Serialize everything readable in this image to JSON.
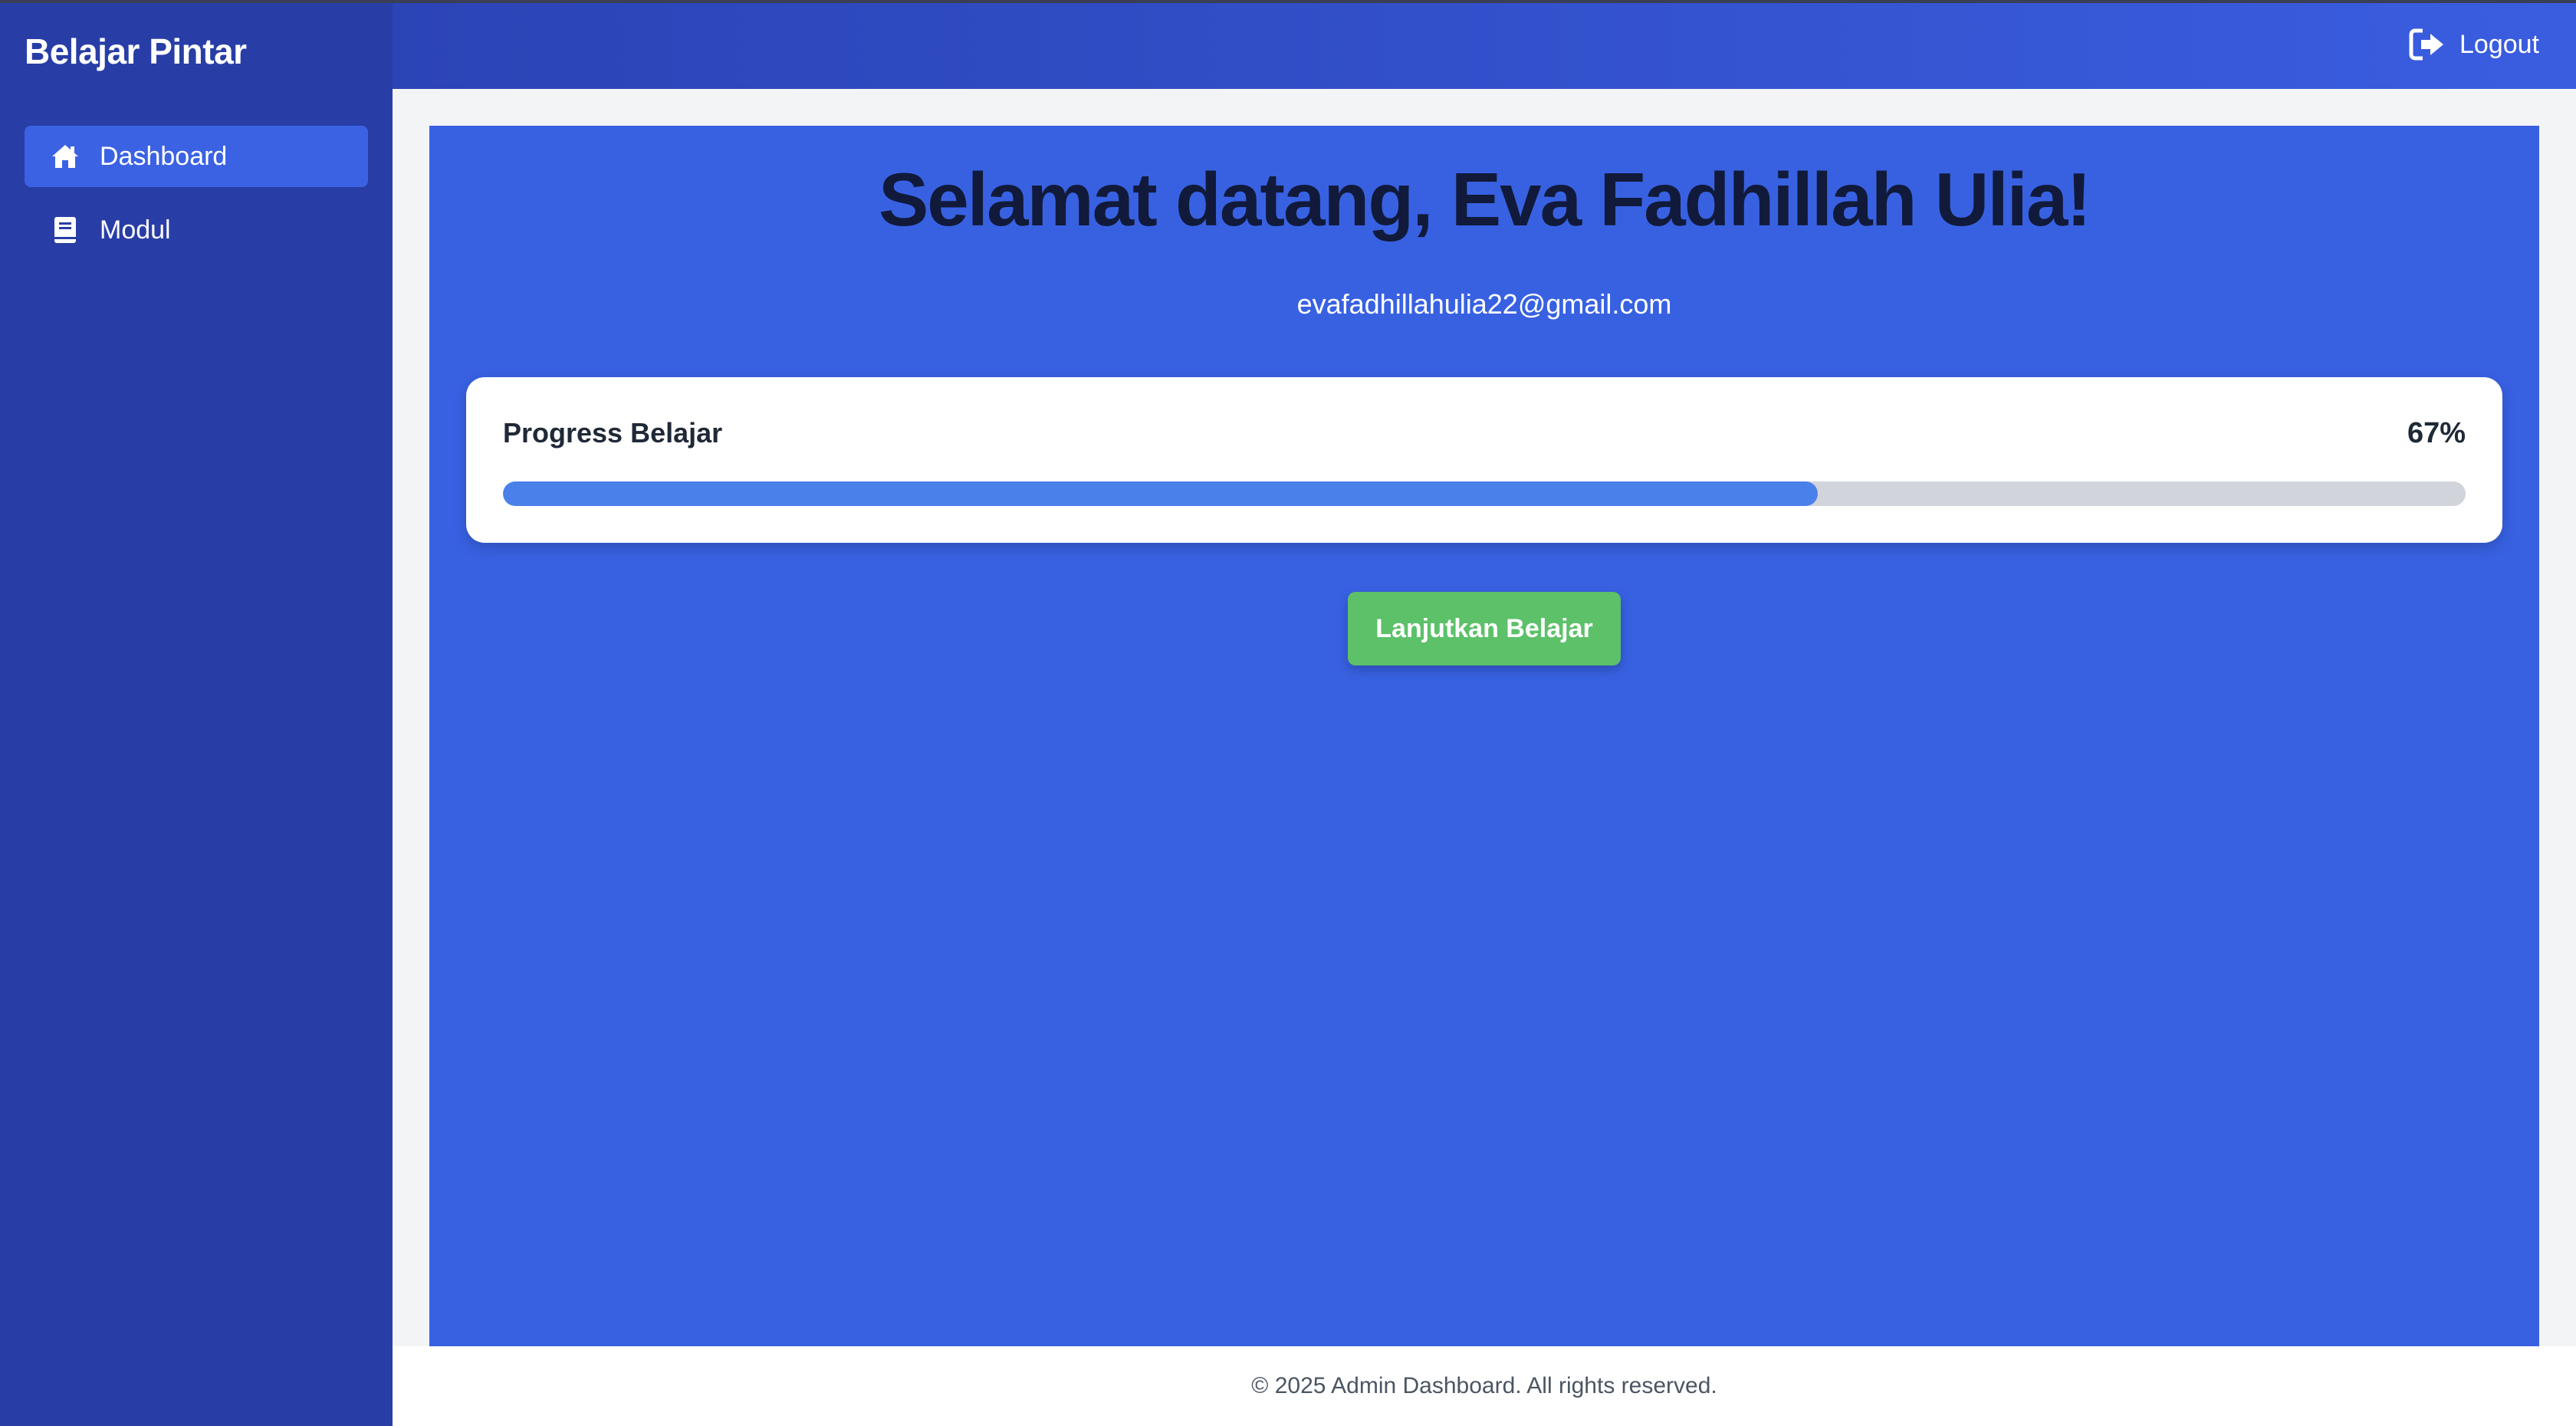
{
  "app": {
    "brand": "Belajar Pintar"
  },
  "sidebar": {
    "items": [
      {
        "label": "Dashboard",
        "icon": "home-icon",
        "active": true
      },
      {
        "label": "Modul",
        "icon": "book-icon",
        "active": false
      }
    ]
  },
  "header": {
    "logout_label": "Logout",
    "logout_icon": "logout-icon"
  },
  "main": {
    "welcome": "Selamat datang, Eva Fadhillah Ulia!",
    "email": "evafadhillahulia22@gmail.com",
    "progress": {
      "label": "Progress Belajar",
      "percent_text": "67%",
      "value": 0.67
    },
    "continue_button": "Lanjutkan Belajar"
  },
  "footer": {
    "text": "© 2025 Admin Dashboard. All rights reserved."
  },
  "colors": {
    "sidebar": "#283ea6",
    "active_nav": "#3b62e3",
    "panel": "#3861e2",
    "progress_fill": "#4a80ea",
    "button": "#5cc169"
  }
}
